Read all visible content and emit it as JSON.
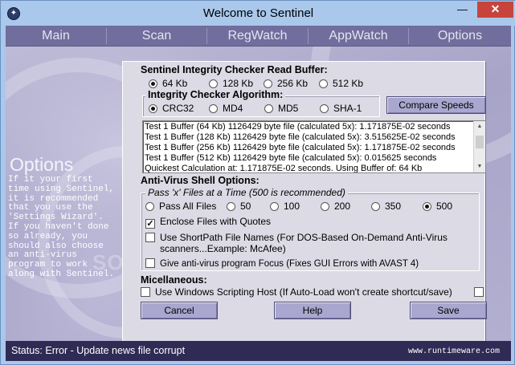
{
  "window": {
    "title": "Welcome to Sentinel",
    "minimize": "—",
    "maximize": "☐",
    "close": "✕",
    "app_icon": "sentinel-logo-icon"
  },
  "nav": [
    "Main",
    "Scan",
    "RegWatch",
    "AppWatch",
    "Options"
  ],
  "side": {
    "title": "Options",
    "text": "If it your first\ntime using Sentinel,\nit is recommended\nthat you use the\n'Settings Wizard'.\nIf you haven't done\nso already, you\nshould also choose\nan anti-virus\nprogram to work\nalong with Sentinel.",
    "watermark": "SOFTPEDIA"
  },
  "read_buffer": {
    "label": "Sentinel Integrity Checker Read Buffer:",
    "options": [
      "64 Kb",
      "128 Kb",
      "256 Kb",
      "512 Kb"
    ],
    "selected": "64 Kb"
  },
  "algorithm": {
    "label": "Integrity Checker Algorithm:",
    "options": [
      "CRC32",
      "MD4",
      "MD5",
      "SHA-1"
    ],
    "selected": "CRC32"
  },
  "compare_button": "Compare Speeds",
  "results": [
    "Test 1 Buffer (64 Kb) 1126429 byte file (calculated 5x): 1.171875E-02 seconds",
    "Test 1 Buffer (128 Kb) 1126429 byte file (calculated 5x): 3.515625E-02 seconds",
    "Test 1 Buffer (256 Kb) 1126429 byte file (calculated 5x): 1.171875E-02 seconds",
    "Test 1 Buffer (512 Kb) 1126429 byte file (calculated 5x): 0.015625 seconds",
    "Quickest Calculation at: 1.171875E-02 seconds. Using Buffer of: 64 Kb"
  ],
  "av_shell": {
    "label": "Anti-Virus Shell Options:",
    "pass_group": "Pass 'x' Files at a Time (500 is recommended)",
    "pass_options": [
      "Pass All Files",
      "50",
      "100",
      "200",
      "350",
      "500"
    ],
    "pass_selected": "500",
    "enclose_quotes": {
      "label": "Enclose Files with Quotes",
      "checked": true
    },
    "short_path": {
      "label_line1": "Use ShortPath File Names (For DOS-Based On-Demand Anti-Virus",
      "label_line2": "scanners...Example: McAfee)",
      "checked": false
    },
    "focus": {
      "label": "Give anti-virus program Focus (Fixes GUI Errors with AVAST 4)",
      "checked": false
    }
  },
  "misc": {
    "label": "Micellaneous:",
    "scripting_host": {
      "label": "Use Windows Scripting Host (If Auto-Load won't create shortcut/save)",
      "checked": false
    }
  },
  "buttons": {
    "cancel": "Cancel",
    "help": "Help",
    "save": "Save"
  },
  "status": {
    "text": "Status: Error - Update news file corrupt",
    "brand": "www.runtimeware.com"
  }
}
